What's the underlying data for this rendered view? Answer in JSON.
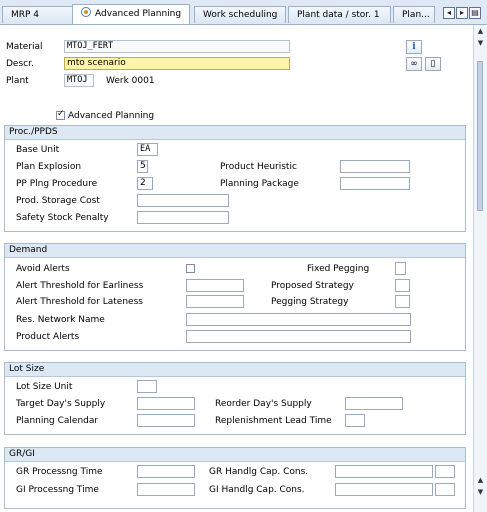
{
  "tabs": [
    {
      "label": "MRP 4"
    },
    {
      "label": "Advanced Planning"
    },
    {
      "label": "Work scheduling"
    },
    {
      "label": "Plant data / stor. 1"
    },
    {
      "label": "Plan..."
    }
  ],
  "header": {
    "material_label": "Material",
    "material_value": "MTOJ_FERT",
    "descr_label": "Descr.",
    "descr_value": "mto scenario",
    "plant_label": "Plant",
    "plant_value": "MTOJ",
    "plant_name": "Werk 0001"
  },
  "advanced_planning": {
    "label": "Advanced Planning",
    "checked": true
  },
  "proc": {
    "title": "Proc./PPDS",
    "base_unit_label": "Base Unit",
    "base_unit_value": "EA",
    "plan_explosion_label": "Plan Explosion",
    "plan_explosion_value": "5",
    "pp_plng_label": "PP Plng Procedure",
    "pp_plng_value": "2",
    "prod_storage_label": "Prod. Storage Cost",
    "prod_storage_value": "",
    "safety_stock_label": "Safety Stock Penalty",
    "safety_stock_value": "",
    "product_heuristic_label": "Product Heuristic",
    "product_heuristic_value": "",
    "planning_package_label": "Planning Package",
    "planning_package_value": ""
  },
  "demand": {
    "title": "Demand",
    "avoid_alerts_label": "Avoid Alerts",
    "earliness_label": "Alert Threshold for Earliness",
    "lateness_label": "Alert Threshold for Lateness",
    "res_network_label": "Res. Network Name",
    "product_alerts_label": "Product Alerts",
    "fixed_pegging_label": "Fixed Pegging",
    "proposed_strategy_label": "Proposed Strategy",
    "pegging_strategy_label": "Pegging Strategy"
  },
  "lotsize": {
    "title": "Lot Size",
    "lot_size_unit_label": "Lot Size Unit",
    "target_days_label": "Target Day's Supply",
    "planning_calendar_label": "Planning Calendar",
    "reorder_days_label": "Reorder Day's Supply",
    "replenishment_label": "Replenishment Lead Time"
  },
  "grgi": {
    "title": "GR/GI",
    "gr_processing_label": "GR Processng Time",
    "gi_processing_label": "GI Processng Time",
    "gr_handlg_label": "GR Handlg Cap. Cons.",
    "gi_handlg_label": "GI Handlg Cap. Cons."
  },
  "icons": {
    "info": "info-icon",
    "glasses": "display-icon",
    "doc": "document-icon"
  }
}
